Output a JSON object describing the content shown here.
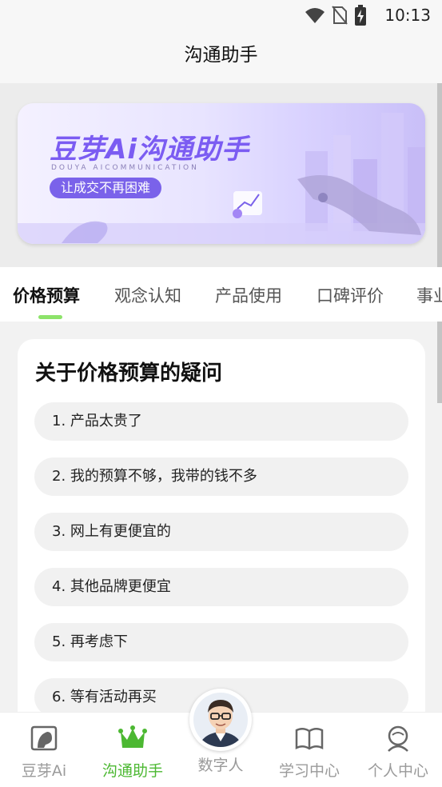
{
  "status": {
    "time": "10:13"
  },
  "header": {
    "title": "沟通助手"
  },
  "banner": {
    "headline": "豆芽Ai沟通助手",
    "subtitle": "DOUYA AICOMMUNICATION",
    "tagline": "让成交不再困难"
  },
  "tabs": [
    {
      "label": "价格预算",
      "active": true
    },
    {
      "label": "观念认知",
      "active": false
    },
    {
      "label": "产品使用",
      "active": false
    },
    {
      "label": "口碑评价",
      "active": false
    },
    {
      "label": "事业",
      "active": false
    }
  ],
  "card": {
    "title": "关于价格预算的疑问",
    "questions": [
      "1. 产品太贵了",
      "2. 我的预算不够，我带的钱不多",
      "3. 网上有更便宜的",
      "4. 其他品牌更便宜",
      "5. 再考虑下",
      "6. 等有活动再买"
    ]
  },
  "tabbar": {
    "items": [
      {
        "label": "豆芽Ai",
        "icon": "doya-icon",
        "active": false
      },
      {
        "label": "沟通助手",
        "icon": "crown-icon",
        "active": true
      },
      {
        "label": "数字人",
        "icon": "avatar",
        "active": false
      },
      {
        "label": "学习中心",
        "icon": "book-icon",
        "active": false
      },
      {
        "label": "个人中心",
        "icon": "person-icon",
        "active": false
      }
    ]
  },
  "colors": {
    "accent": "#4cb832",
    "tab_indicator": "#8de36a",
    "banner_purple": "#7b5cf2"
  }
}
